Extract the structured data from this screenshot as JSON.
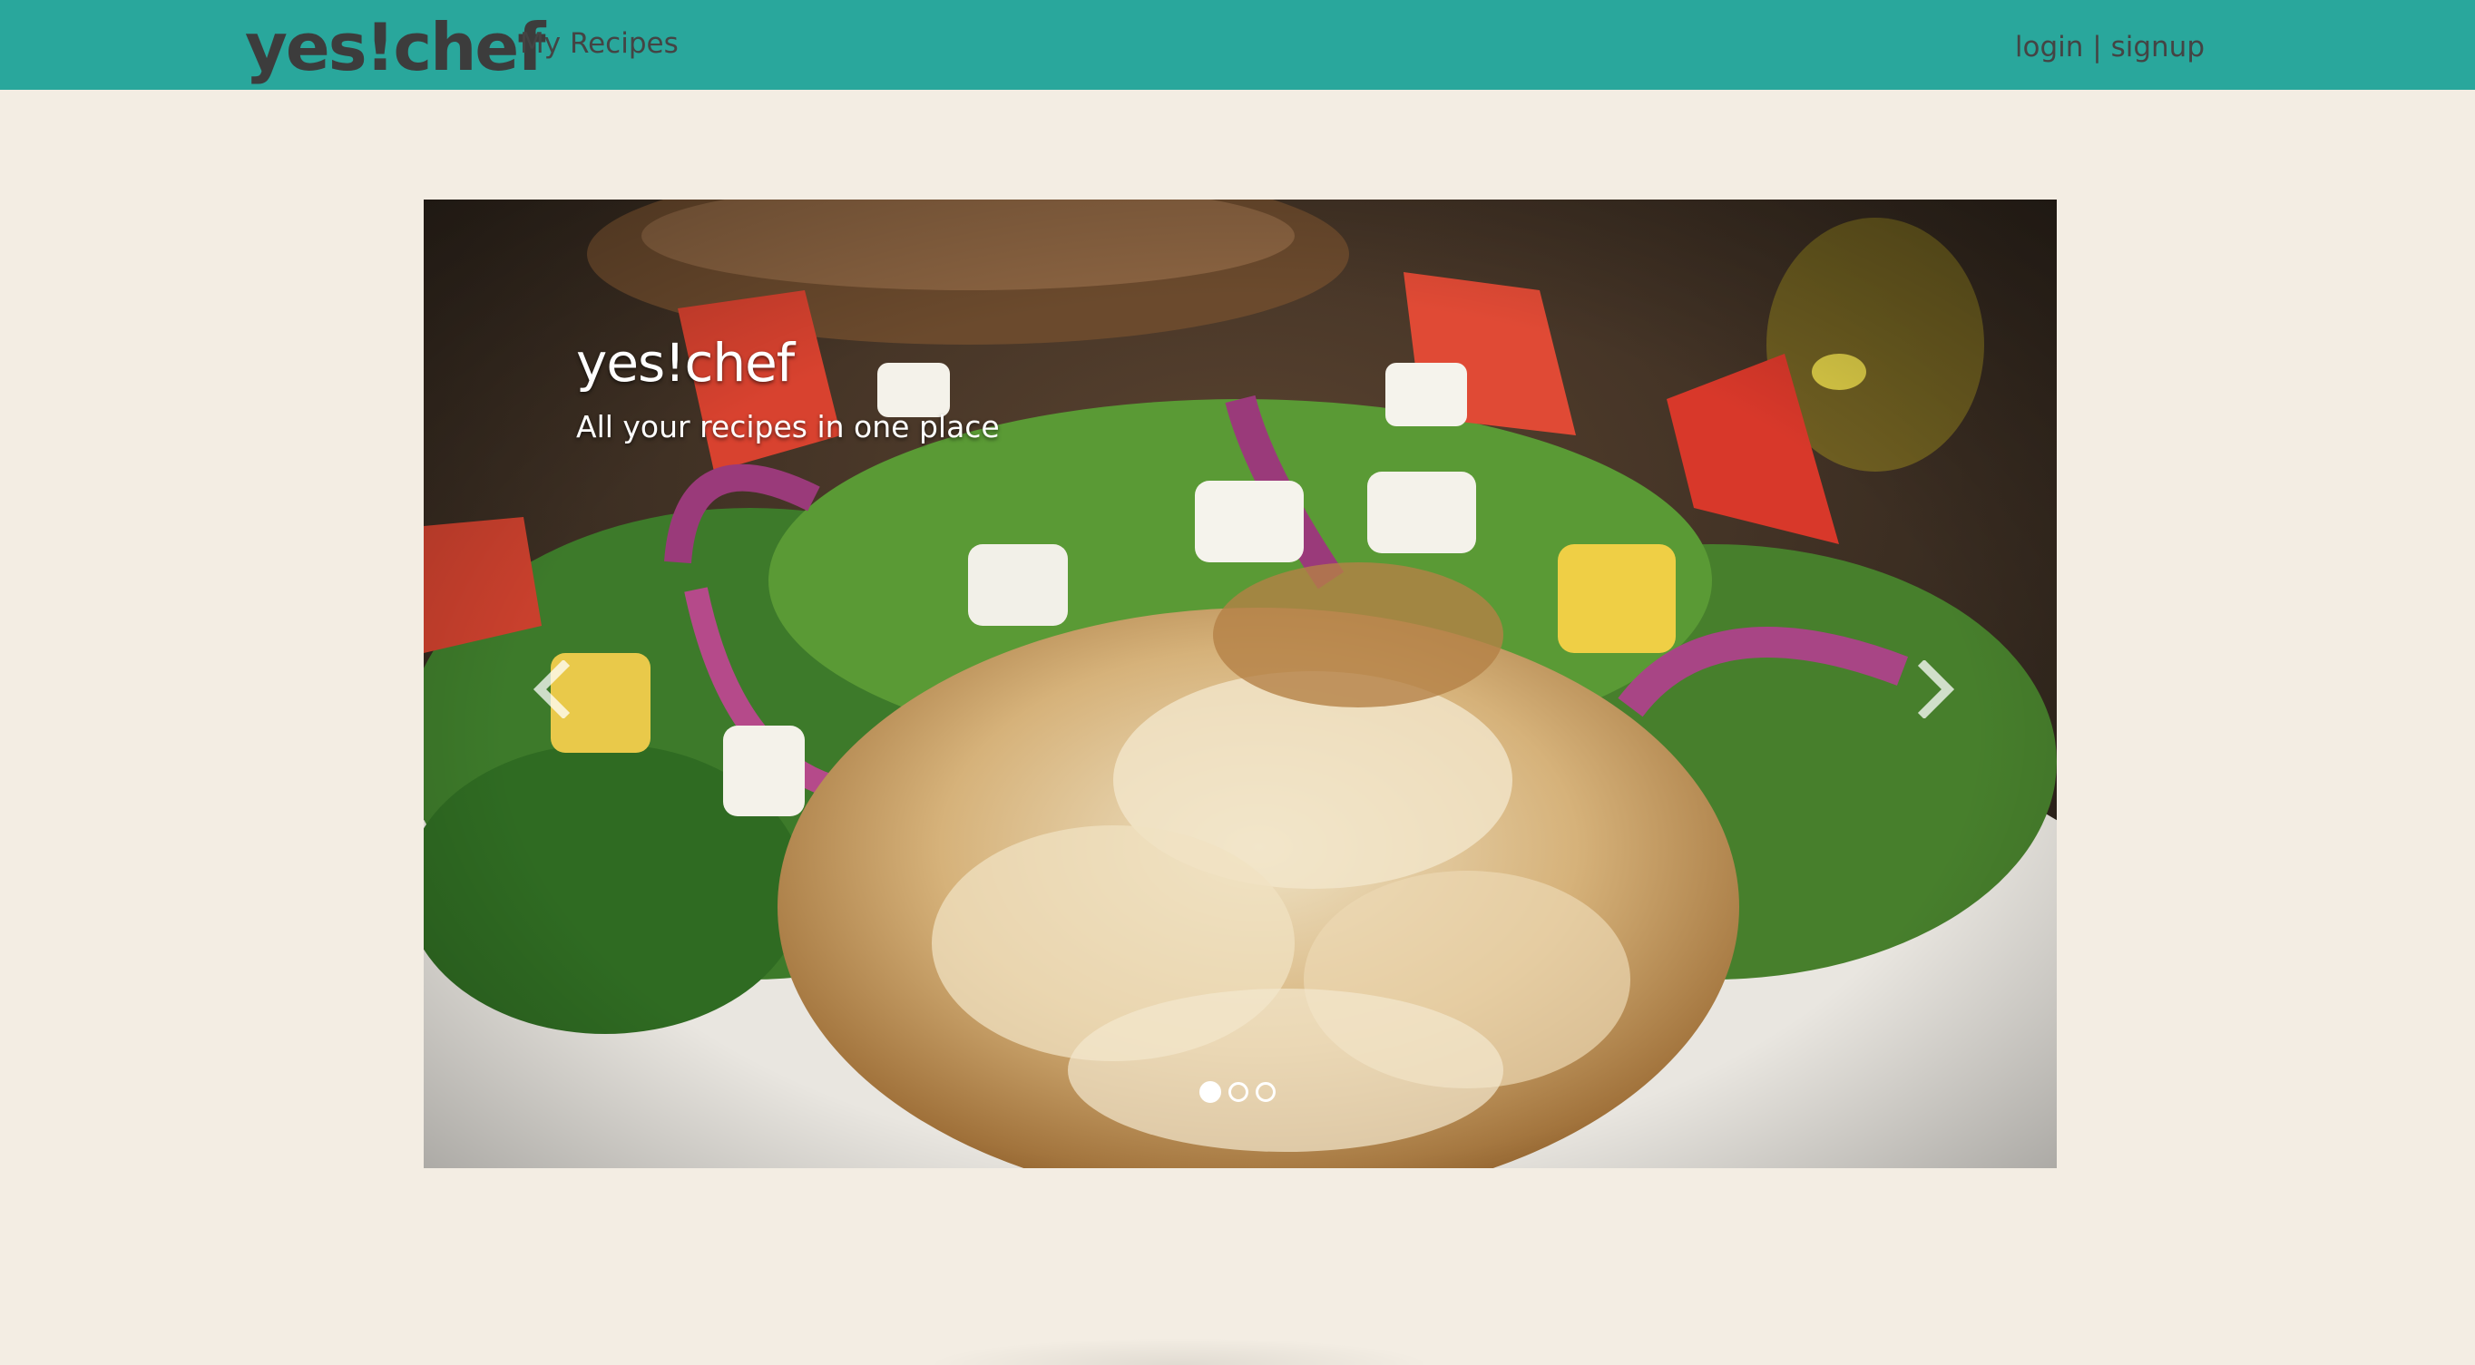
{
  "navbar": {
    "brand": "yes!chef",
    "my_recipes": "My Recipes",
    "login": "login",
    "separator": " | ",
    "signup": "signup"
  },
  "carousel": {
    "caption_title": "yes!chef",
    "caption_subtitle": "All your recipes in one place",
    "slide_count": 3,
    "active_slide": 1,
    "prev_icon": "chevron-left-icon",
    "next_icon": "chevron-right-icon"
  },
  "colors": {
    "navbar": "#29a79c",
    "page_background": "#f3ede3",
    "nav_text": "#444444",
    "caption_text": "#ffffff"
  }
}
